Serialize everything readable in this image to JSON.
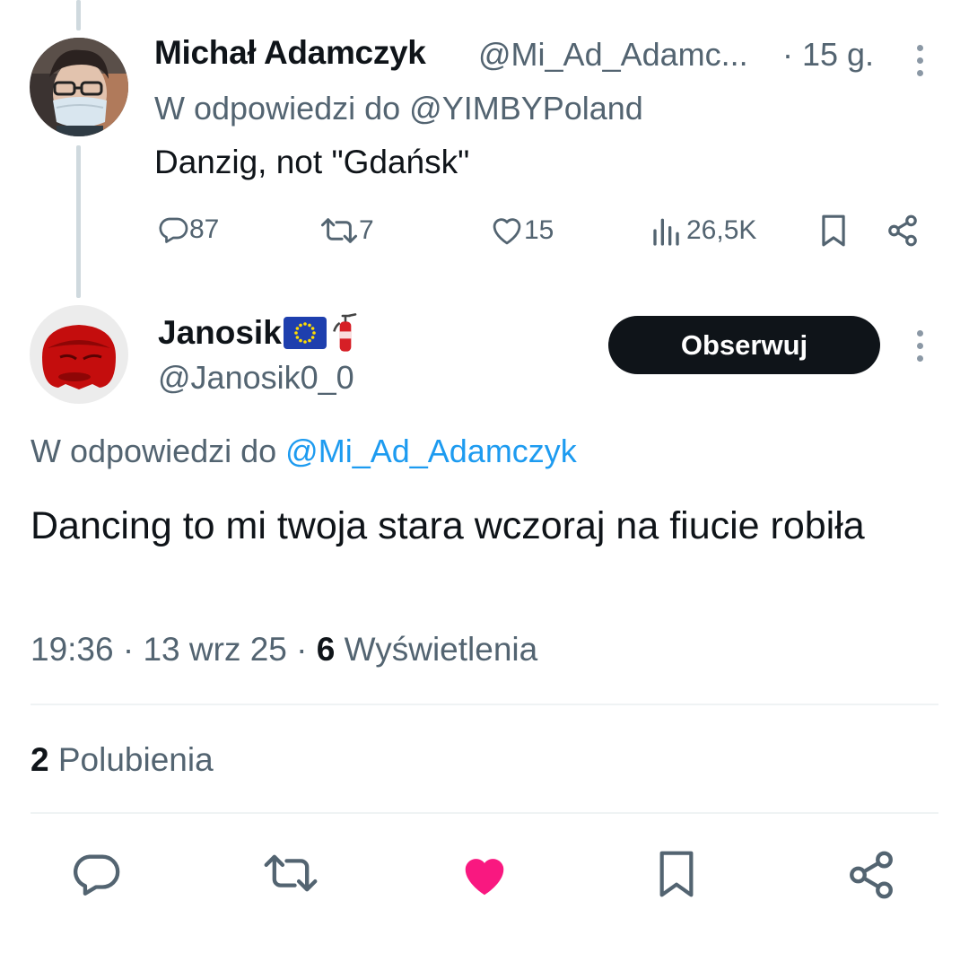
{
  "tweet1": {
    "author_name": "Michał Adamczyk",
    "author_handle": "@Mi_Ad_Adamc...",
    "time": "· 15 g.",
    "reply_prefix": "W odpowiedzi do ",
    "reply_mention": "@YIMBYPoland",
    "text": "Danzig, not \"Gdańsk\"",
    "actions": {
      "replies": "87",
      "retweets": "7",
      "likes": "15",
      "views": "26,5K"
    }
  },
  "tweet2": {
    "author_name": "Janosik",
    "author_emoji": "🧯",
    "author_handle": "@Janosik0_0",
    "follow_label": "Obserwuj",
    "reply_prefix": "W odpowiedzi do ",
    "reply_mention": "@Mi_Ad_Adamczyk",
    "text": "Dancing to mi twoja stara wczoraj na fiucie robiła",
    "time": "19:36 · 13 wrz 25 · ",
    "views_count": "6",
    "views_label": " Wyświetlenia",
    "likes_count": "2",
    "likes_label": " Polubienia"
  },
  "colors": {
    "text": "#0f1419",
    "secondary": "#536471",
    "link": "#1d9bf0",
    "like_active": "#f91880",
    "follow_bg": "#0f1419",
    "thread_line": "#cfd9de"
  },
  "icons": {
    "reply": "speech-bubble-icon",
    "retweet": "retweet-arrows-icon",
    "like": "heart-icon",
    "views": "bar-chart-icon",
    "bookmark": "bookmark-icon",
    "share": "share-nodes-icon",
    "more": "three-dots-vertical-icon",
    "flag": "eu-flag-icon"
  }
}
